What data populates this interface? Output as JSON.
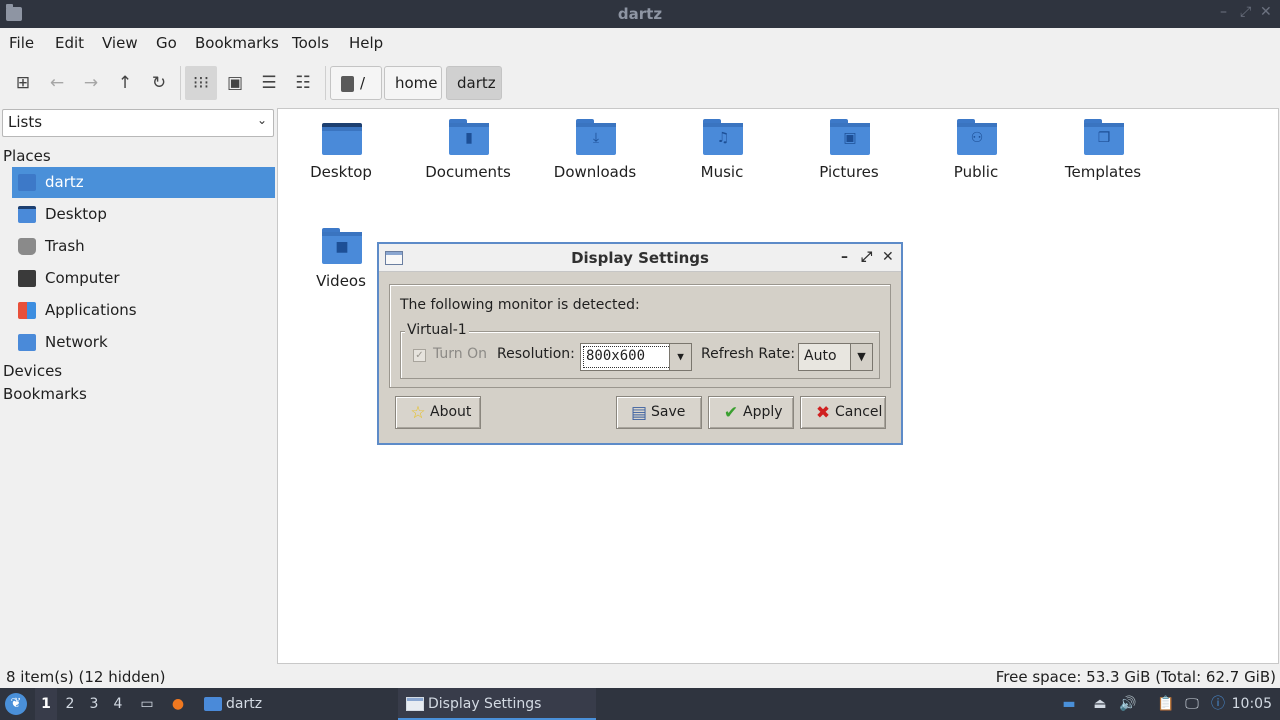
{
  "window": {
    "title": "dartz"
  },
  "menu": [
    "File",
    "Edit",
    "View",
    "Go",
    "Bookmarks",
    "Tools",
    "Help"
  ],
  "breadcrumb": {
    "root": "/",
    "items": [
      "home",
      "dartz"
    ]
  },
  "sidebar": {
    "combo_value": "Lists",
    "places_header": "Places",
    "places": [
      {
        "label": "dartz",
        "icon": "home-folder-icon",
        "selected": true
      },
      {
        "label": "Desktop",
        "icon": "desktop-icon"
      },
      {
        "label": "Trash",
        "icon": "trash-icon"
      },
      {
        "label": "Computer",
        "icon": "computer-icon"
      },
      {
        "label": "Applications",
        "icon": "applications-icon"
      },
      {
        "label": "Network",
        "icon": "network-icon"
      }
    ],
    "devices_header": "Devices",
    "bookmarks_header": "Bookmarks"
  },
  "files": [
    {
      "name": "Desktop",
      "icon": "desktop-folder-icon"
    },
    {
      "name": "Documents",
      "icon": "documents-folder-icon"
    },
    {
      "name": "Downloads",
      "icon": "downloads-folder-icon"
    },
    {
      "name": "Music",
      "icon": "music-folder-icon"
    },
    {
      "name": "Pictures",
      "icon": "pictures-folder-icon"
    },
    {
      "name": "Public",
      "icon": "public-folder-icon"
    },
    {
      "name": "Templates",
      "icon": "templates-folder-icon"
    },
    {
      "name": "Videos",
      "icon": "videos-folder-icon"
    }
  ],
  "status": {
    "left": "8 item(s) (12 hidden)",
    "right": "Free space: 53.3 GiB (Total: 62.7 GiB)"
  },
  "dialog": {
    "title": "Display Settings",
    "message": "The following monitor is detected:",
    "monitor": "Virtual-1",
    "turn_on_label": "Turn On",
    "turn_on_checked": true,
    "resolution_label": "Resolution:",
    "resolution_value": "800x600",
    "refresh_label": "Refresh Rate:",
    "refresh_value": "Auto",
    "buttons": {
      "about": "About",
      "save": "Save",
      "apply": "Apply",
      "cancel": "Cancel"
    }
  },
  "taskbar": {
    "workspaces": [
      "1",
      "2",
      "3",
      "4"
    ],
    "current_workspace": "1",
    "window_dartz": "dartz",
    "window_display": "Display Settings",
    "clock": "10:05"
  },
  "colors": {
    "accent": "#4a90d9",
    "panel": "#2f343f",
    "dialog_bg": "#d4d0c8"
  }
}
